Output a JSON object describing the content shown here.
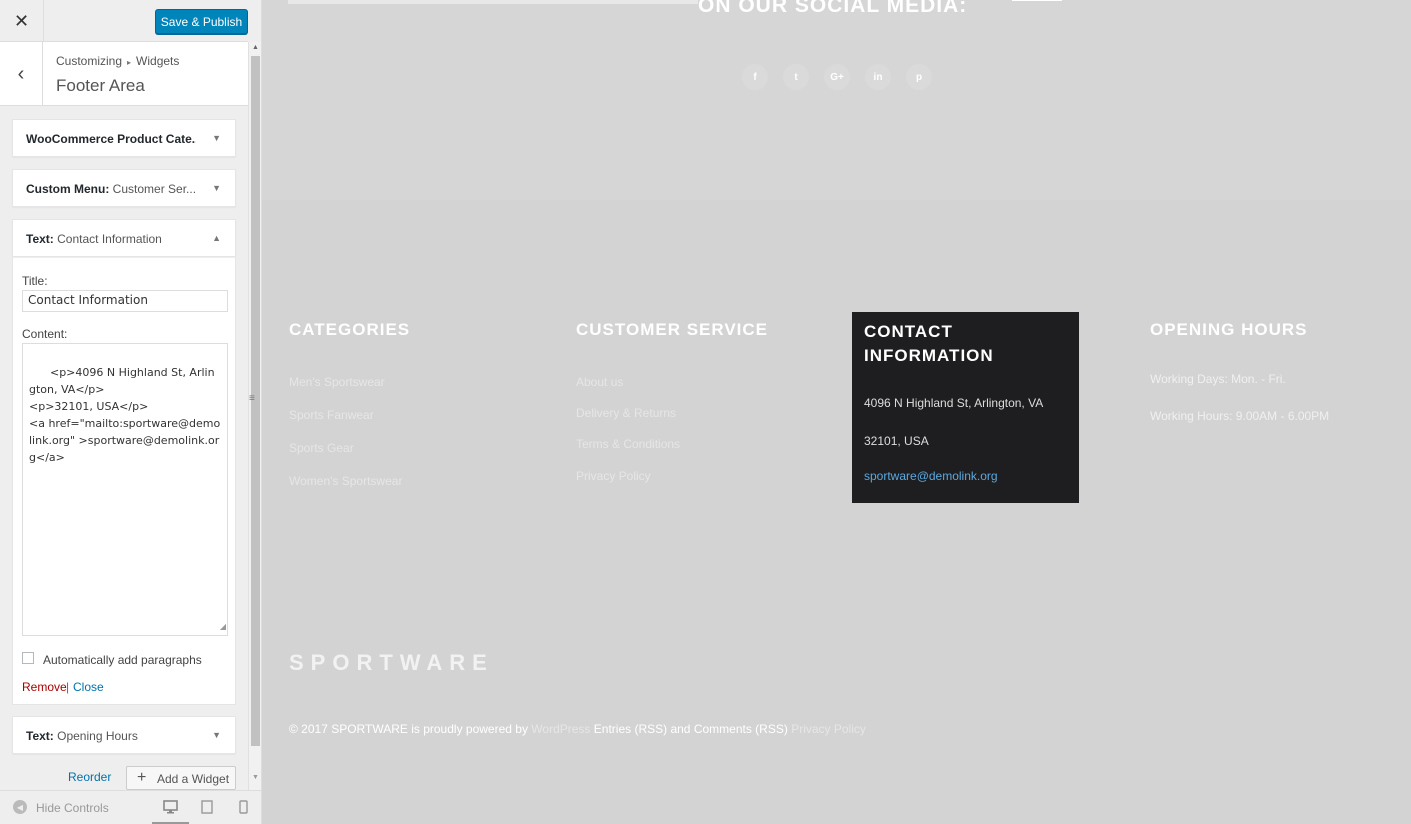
{
  "customizer": {
    "close_glyph": "✕",
    "save_label": "Save & Publish",
    "breadcrumb": [
      "Customizing",
      "Widgets"
    ],
    "section_title": "Footer Area",
    "widgets": [
      {
        "type": "WooCommerce Product Cate...",
        "instance": "",
        "expanded": false
      },
      {
        "type": "Custom Menu:",
        "instance": "Customer Ser...",
        "expanded": false
      },
      {
        "type": "Text:",
        "instance": "Contact Information",
        "expanded": true
      },
      {
        "type": "Text:",
        "instance": "Opening Hours",
        "expanded": false
      }
    ],
    "form": {
      "title_label": "Title:",
      "title_value": "Contact Information",
      "content_label": "Content:",
      "content_value": "<p>4096 N Highland St, Arlington, VA</p>\n<p>32101, USA</p>\n<a href=\"mailto:sportware@demolink.org\" >sportware@demolink.org</a>",
      "auto_paragraphs_label": "Automatically add paragraphs",
      "auto_paragraphs_checked": false,
      "remove_label": "Remove",
      "separator": "|",
      "close_label": "Close"
    },
    "reorder_label": "Reorder",
    "add_widget_label": "Add a Widget",
    "hide_controls_label": "Hide Controls",
    "preview_devices": [
      "desktop-icon",
      "tablet-icon",
      "mobile-icon"
    ],
    "accent_color": "#0085ba"
  },
  "preview": {
    "social_heading": "ON OUR SOCIAL MEDIA:",
    "social_icons": [
      "f",
      "t",
      "G+",
      "in",
      "p"
    ],
    "columns": {
      "categories": {
        "heading": "CATEGORIES",
        "links": [
          "Men's Sportswear",
          "Sports Fanwear",
          "Sports Gear",
          "Women's Sportswear"
        ]
      },
      "customer_service": {
        "heading": "CUSTOMER SERVICE",
        "links": [
          "About us",
          "Delivery & Returns",
          "Terms & Conditions",
          "Privacy Policy"
        ]
      },
      "contact": {
        "heading": "CONTACT INFORMATION",
        "address": "4096 N Highland St, Arlington, VA",
        "zip": "32101, USA",
        "email": "sportware@demolink.org"
      },
      "opening_hours": {
        "heading": "OPENING HOURS",
        "lines": [
          "Working Days: Mon. - Fri.",
          "Working Hours: 9.00AM - 6.00PM"
        ]
      }
    },
    "logo": "SPORTWARE",
    "copyright": {
      "prefix": "© 2017 SPORTWARE is proudly powered by",
      "wordpress": "WordPress",
      "feeds": "Entries (RSS) and Comments (RSS)",
      "privacy": "Privacy Policy"
    }
  }
}
